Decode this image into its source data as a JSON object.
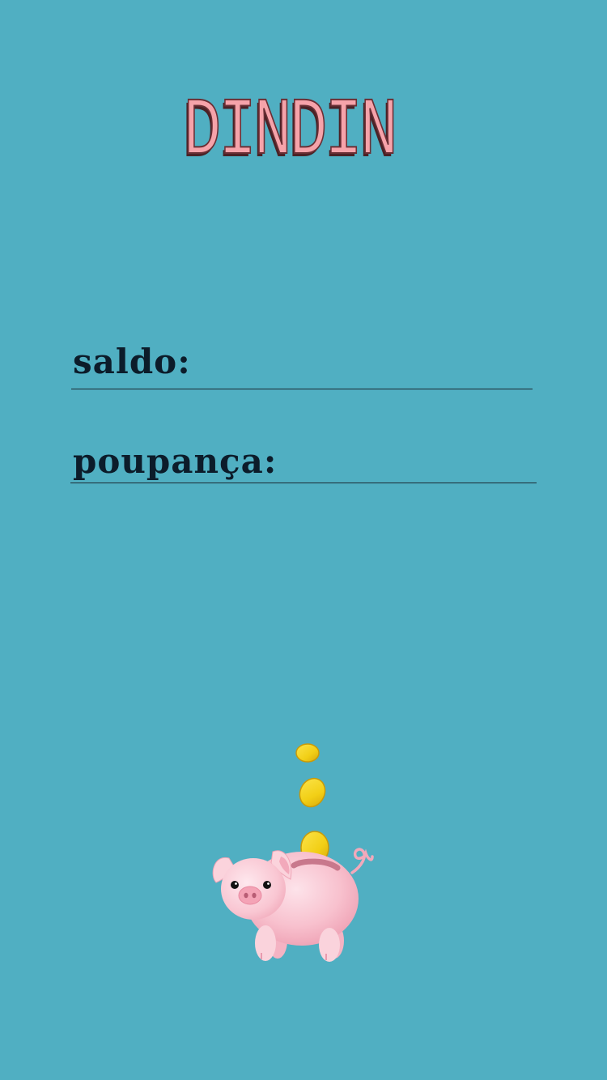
{
  "app": {
    "title": "DINDIN"
  },
  "fields": {
    "saldo": {
      "label": "saldo:",
      "value": ""
    },
    "poupanca": {
      "label": "poupança:",
      "value": ""
    }
  },
  "illustration": {
    "icon": "piggy-bank-icon",
    "coin_icon": "coin-icon"
  },
  "colors": {
    "background": "#50afc2",
    "title_fill": "#f6a3aa",
    "title_shadow": "#4a2226",
    "text": "#0c1c2a",
    "pig_pink": "#f8c1ce",
    "coin_gold": "#f2cf16"
  }
}
